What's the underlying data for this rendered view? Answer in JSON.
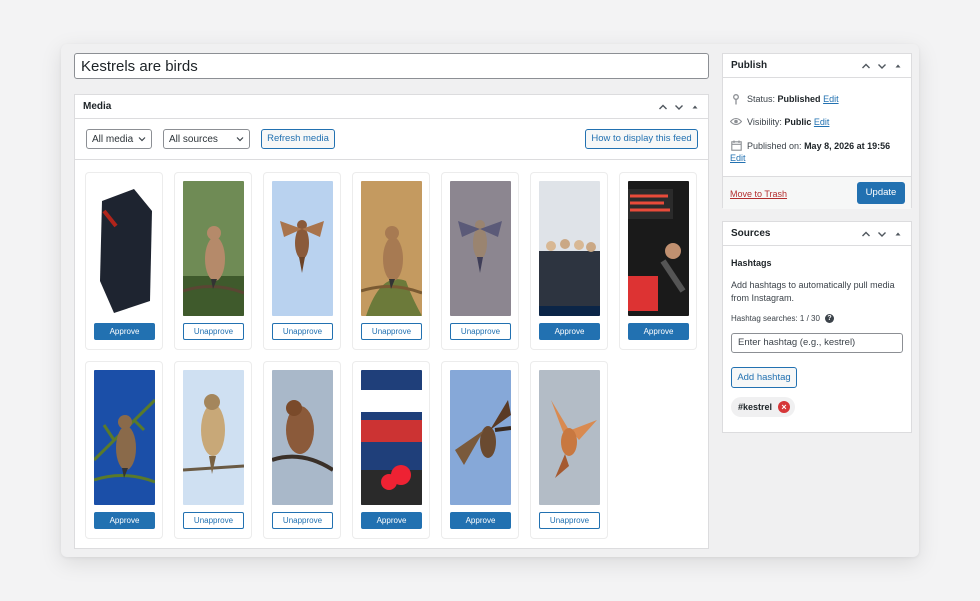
{
  "post": {
    "title": "Kestrels are birds"
  },
  "media": {
    "title": "Media",
    "filter_media": "All media",
    "filter_sources": "All sources",
    "refresh_label": "Refresh media",
    "how_to_label": "How to display this feed",
    "items": [
      {
        "thumb": "bag-photo",
        "button": "Approve",
        "state": "approve"
      },
      {
        "thumb": "kestrel-perched-green",
        "button": "Unapprove",
        "state": "unapprove"
      },
      {
        "thumb": "kestrel-flying-sky",
        "button": "Unapprove",
        "state": "unapprove"
      },
      {
        "thumb": "kestrel-on-plant",
        "button": "Unapprove",
        "state": "unapprove"
      },
      {
        "thumb": "kestrel-wings-spread",
        "button": "Unapprove",
        "state": "unapprove"
      },
      {
        "thumb": "group-event-photo",
        "button": "Approve",
        "state": "approve"
      },
      {
        "thumb": "cyclist-poster",
        "button": "Approve",
        "state": "approve"
      },
      {
        "thumb": "kestrel-branch-blue",
        "button": "Approve",
        "state": "approve"
      },
      {
        "thumb": "kestrel-perched-pale",
        "button": "Unapprove",
        "state": "unapprove"
      },
      {
        "thumb": "kestrel-on-branch",
        "button": "Unapprove",
        "state": "unapprove"
      },
      {
        "thumb": "meetup-poster",
        "button": "Approve",
        "state": "approve"
      },
      {
        "thumb": "kestrel-landing",
        "button": "Approve",
        "state": "approve"
      },
      {
        "thumb": "kestrel-hovering-orange",
        "button": "Unapprove",
        "state": "unapprove"
      }
    ]
  },
  "publish": {
    "title": "Publish",
    "status_label": "Status:",
    "status_value": "Published",
    "visibility_label": "Visibility:",
    "visibility_value": "Public",
    "published_label": "Published on:",
    "published_value": "May 8, 2026 at 19:56",
    "edit_label": "Edit",
    "trash_label": "Move to Trash",
    "update_label": "Update"
  },
  "sources": {
    "title": "Sources",
    "subtitle": "Hashtags",
    "description": "Add hashtags to automatically pull media from Instagram.",
    "count_label": "Hashtag searches: 1 / 30",
    "input_placeholder": "Enter hashtag (e.g., kestrel)",
    "add_label": "Add hashtag",
    "tags": [
      "#kestrel"
    ]
  },
  "colors": {
    "accent": "#2271b1",
    "danger": "#d63638",
    "trash": "#b32d2e"
  }
}
